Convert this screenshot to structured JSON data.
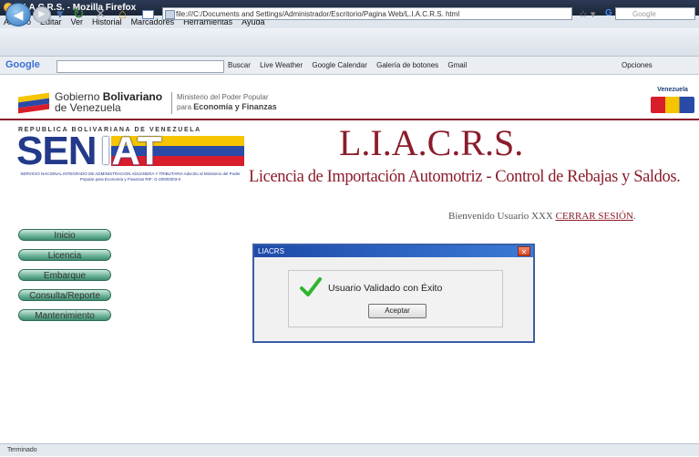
{
  "window": {
    "title": "L.I.A.C.R.S. - Mozilla Firefox"
  },
  "menubar": [
    "Archivo",
    "Editar",
    "Ver",
    "Historial",
    "Marcadores",
    "Herramientas",
    "Ayuda"
  ],
  "navbar": {
    "url": "file:///C:/Documents and Settings/Administrador/Escritorio/Pagina Web/L.I.A.C.R.S. html",
    "search_placeholder": "Google"
  },
  "google_toolbar": {
    "logo": "Google",
    "items": [
      "Buscar",
      "Live Weather",
      "Google Calendar",
      "Galería de botones",
      "Gmail"
    ],
    "options": "Opciones"
  },
  "gov_header": {
    "gov_line1": "Gobierno ",
    "gov_bold": "Bolivariano",
    "gov_line2": "de Venezuela",
    "ministry_line1": "Ministerio del Poder Popular",
    "ministry_line2": "para ",
    "ministry_bold": "Economía y Finanzas",
    "country_logo": "Venezuela"
  },
  "seniat": {
    "republic": "REPUBLICA BOLIVARIANA DE VENEZUELA",
    "logo_left": "SEN",
    "logo_right": "IAT",
    "subtitle": "SERVICIO NACIONAL INTEGRADO DE ADMINISTRACION ADUANERA Y TRIBUTARIA Adscrito al Ministerio del Poder Popular para Economía y Finanzas RIF: G-20000303-0"
  },
  "app": {
    "title": "L.I.A.C.R.S.",
    "subtitle": "Licencia de Importación Automotriz - Control de Rebajas y Saldos."
  },
  "welcome": {
    "text": "Bienvenido Usuario XXX ",
    "logout": "CERRAR SESIÓN"
  },
  "sidebar": {
    "items": [
      {
        "label": "Inicio"
      },
      {
        "label": "Licencia"
      },
      {
        "label": "Embarque"
      },
      {
        "label": "Consulta/Reporte"
      },
      {
        "label": "Mantenimiento"
      }
    ]
  },
  "dialog": {
    "title": "LIACRS",
    "message": "Usuario Validado con Éxito",
    "button": "Aceptar"
  },
  "status": {
    "text": "Terminado"
  },
  "colors": {
    "accent": "#8b1c2b",
    "seniat_blue": "#233a8a",
    "menu_green": "#4f9c80"
  }
}
